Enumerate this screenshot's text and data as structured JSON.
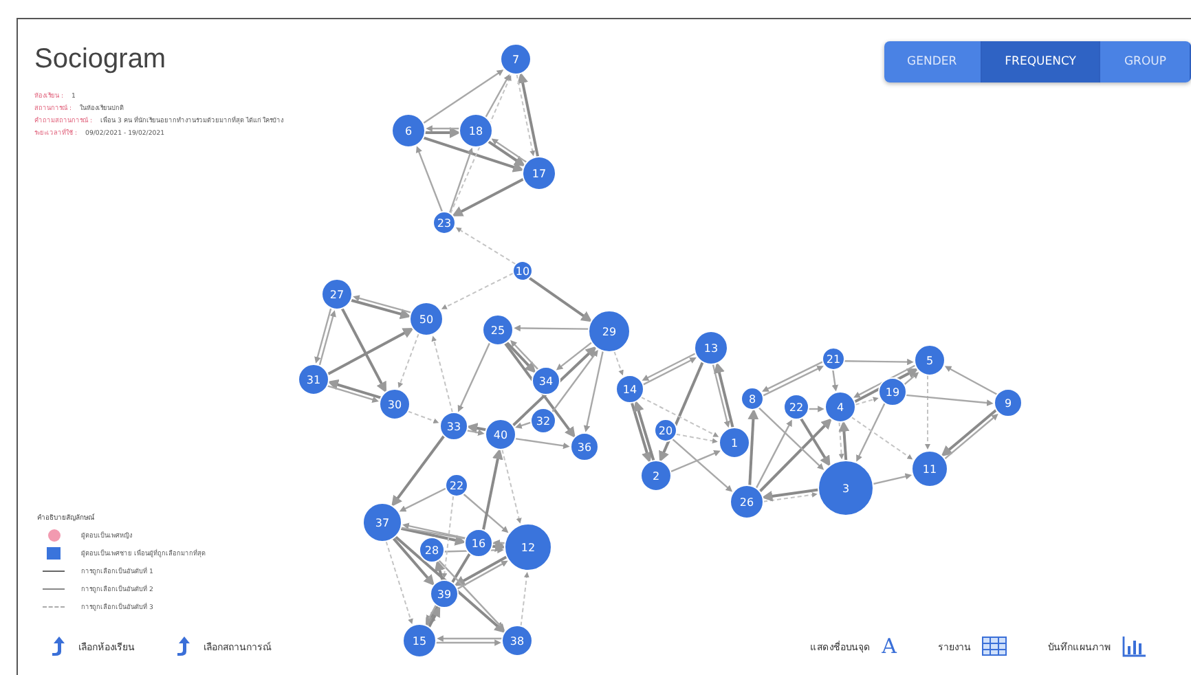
{
  "header": {
    "title": "Sociogram"
  },
  "info": [
    {
      "label": "ห้องเรียน :",
      "value": "1"
    },
    {
      "label": "สถานการณ์ :",
      "value": "ในห้องเรียนปกติ"
    },
    {
      "label": "คำถามสถานการณ์ :",
      "value": "เพื่อน 3 คน ที่นักเรียนอยากทำงานร่วมด้วยมากที่สุด ได้แก่ ใครบ้าง"
    },
    {
      "label": "ระยะเวลาที่ใช้ :",
      "value": "09/02/2021 - 19/02/2021"
    }
  ],
  "view_tabs": [
    {
      "label": "GENDER",
      "selected": false
    },
    {
      "label": "FREQUENCY",
      "selected": true
    },
    {
      "label": "GROUP",
      "selected": false
    }
  ],
  "nodes": [
    {
      "label": "7"
    },
    {
      "label": "6"
    },
    {
      "label": "18"
    },
    {
      "label": "17"
    },
    {
      "label": "23"
    },
    {
      "label": "10"
    },
    {
      "label": "27"
    },
    {
      "label": "50"
    },
    {
      "label": "25"
    },
    {
      "label": "29"
    },
    {
      "label": "31"
    },
    {
      "label": "30"
    },
    {
      "label": "34"
    },
    {
      "label": "32"
    },
    {
      "label": "33"
    },
    {
      "label": "40"
    },
    {
      "label": "36"
    },
    {
      "label": "14"
    },
    {
      "label": "13"
    },
    {
      "label": "20"
    },
    {
      "label": "1"
    },
    {
      "label": "2"
    },
    {
      "label": "8"
    },
    {
      "label": "21"
    },
    {
      "label": "5"
    },
    {
      "label": "22"
    },
    {
      "label": "4"
    },
    {
      "label": "19"
    },
    {
      "label": "9"
    },
    {
      "label": "26"
    },
    {
      "label": "3"
    },
    {
      "label": "11"
    },
    {
      "label": "22"
    },
    {
      "label": "37"
    },
    {
      "label": "28"
    },
    {
      "label": "16"
    },
    {
      "label": "12"
    },
    {
      "label": "39"
    },
    {
      "label": "15"
    },
    {
      "label": "38"
    }
  ],
  "legend": {
    "title": "คำอธิบายสัญลักษณ์",
    "items": [
      {
        "kind": "female",
        "label": "ผู้ตอบเป็นเพศหญิง"
      },
      {
        "kind": "male",
        "label": "ผู้ตอบเป็นเพศชาย เพื่อนผู้ที่ถูกเลือกมากที่สุด"
      },
      {
        "kind": "rank1",
        "label": "การถูกเลือกเป็นอันดับที่ 1"
      },
      {
        "kind": "rank2",
        "label": "การถูกเลือกเป็นอันดับที่ 2"
      },
      {
        "kind": "rank3",
        "label": "การถูกเลือกเป็นอันดับที่ 3"
      }
    ]
  },
  "footer": {
    "left": [
      {
        "label": "เลือกห้องเรียน"
      },
      {
        "label": "เลือกสถานการณ์"
      }
    ],
    "right": [
      {
        "kind": "letter",
        "label": "แสดงชื่อบนจุด",
        "glyph": "A"
      },
      {
        "kind": "table",
        "label": "รายงาน"
      },
      {
        "kind": "chart",
        "label": "บันทึกแผนภาพ"
      }
    ]
  }
}
